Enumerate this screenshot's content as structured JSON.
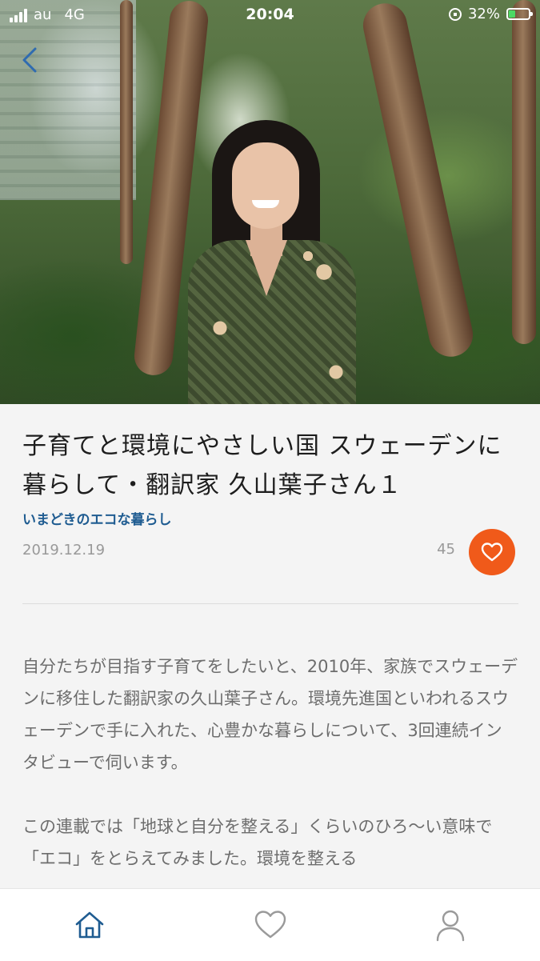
{
  "status_bar": {
    "carrier": "au",
    "network": "4G",
    "time": "20:04",
    "battery": "32%",
    "battery_level": 0.32,
    "battery_color": "#4cd964"
  },
  "nav": {
    "back_icon": "chevron-left-icon"
  },
  "article": {
    "title": "子育てと環境にやさしい国 スウェーデンに暮らして・翻訳家 久山葉子さん１",
    "category": "いまどきのエコな暮らし",
    "date": "2019.12.19",
    "like_count": "45",
    "like_icon": "heart-icon",
    "accent_color": "#f05a1a",
    "category_color": "#1f5c91",
    "paragraphs": [
      "自分たちが目指す子育てをしたいと、2010年、家族でスウェーデンに移住した翻訳家の久山葉子さん。環境先進国といわれるスウェーデンで手に入れた、心豊かな暮らしについて、3回連続インタビューで伺います。",
      "この連載では「地球と自分を整える」くらいのひろ〜い意味で「エコ」をとらえてみました。環境を整える"
    ]
  },
  "tab_bar": {
    "items": [
      {
        "name": "home",
        "icon": "home-icon",
        "active": true,
        "color": "#1f5c91"
      },
      {
        "name": "favorites",
        "icon": "heart-outline-icon",
        "active": false,
        "color": "#9a9a9a"
      },
      {
        "name": "account",
        "icon": "user-icon",
        "active": false,
        "color": "#9a9a9a"
      }
    ]
  }
}
